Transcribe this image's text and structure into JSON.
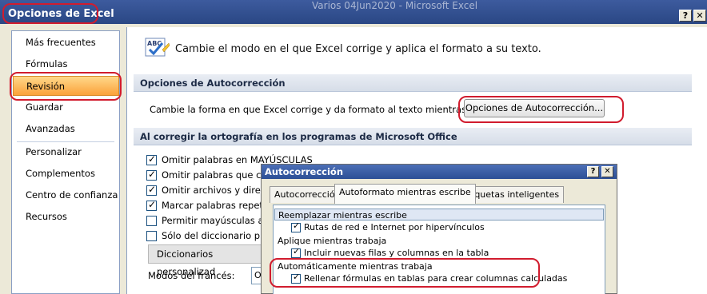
{
  "window": {
    "faded_title": "Varios 04Jun2020 - Microsoft Excel",
    "title": "Opciones de Excel",
    "help_label": "?",
    "close_label": "✕"
  },
  "nav": {
    "items": [
      {
        "label": "Más frecuentes"
      },
      {
        "label": "Fórmulas"
      },
      {
        "label": "Revisión",
        "active": true
      },
      {
        "label": "Guardar"
      },
      {
        "label": "Avanzadas"
      },
      {
        "label": "Personalizar"
      },
      {
        "label": "Complementos"
      },
      {
        "label": "Centro de confianza"
      },
      {
        "label": "Recursos"
      }
    ]
  },
  "main": {
    "headline": "Cambie el modo en el que Excel corrige y aplica el formato a su texto.",
    "section_autocorrect": "Opciones de Autocorrección",
    "autocorrect_text": "Cambie la forma en que Excel corrige y da formato al texto mientras escribe:",
    "autocorrect_button": "Opciones de Autocorrección...",
    "section_spelling": "Al corregir la ortografía en los programas de Microsoft Office",
    "checks": [
      {
        "label": "Omitir palabras en MAYÚSCULAS",
        "checked": true
      },
      {
        "label": "Omitir palabras que cor",
        "checked": true
      },
      {
        "label": "Omitir archivos y direcci",
        "checked": true
      },
      {
        "label": "Marcar palabras repetid",
        "checked": true
      },
      {
        "label": "Permitir mayúsculas ace",
        "checked": false
      },
      {
        "label": "Sólo del diccionario prin",
        "checked": false
      }
    ],
    "dict_button": "Diccionarios personalizad",
    "french_label": "Modos del francés:",
    "select_value": "O"
  },
  "dialog": {
    "title": "Autocorrección",
    "help_label": "?",
    "close_label": "✕",
    "tabs": [
      "Autocorrección",
      "Autoformato mientras escribe",
      "Etiquetas inteligentes"
    ],
    "list": {
      "group1": "Reemplazar mientras escribe",
      "item1": "Rutas de red e Internet por hipervínculos",
      "group2": "Aplique mientras trabaja",
      "item2": "Incluir nuevas filas y columnas en la tabla",
      "group3": "Automáticamente mientras trabaja",
      "item3": "Rellenar fórmulas en tablas para crear columnas calculadas"
    }
  },
  "colors": {
    "annotation": "#d11c2e",
    "active_nav": "#fba23a",
    "title_bar": "#2a4784"
  }
}
